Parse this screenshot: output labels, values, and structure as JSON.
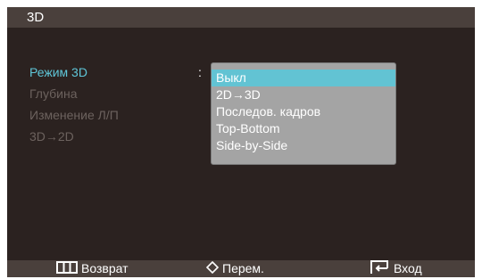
{
  "osd": {
    "title": "3D",
    "menu": [
      {
        "label": "Режим 3D",
        "active": true
      },
      {
        "label": "Глубина",
        "active": false
      },
      {
        "label": "Изменение Л/П",
        "active": false
      },
      {
        "label": "3D→2D",
        "active": false
      }
    ],
    "separator": ":",
    "dropdown": {
      "options": [
        "Выкл",
        "2D→3D",
        "Последов. кадров",
        "Top-Bottom",
        "Side-by-Side"
      ],
      "selected": "Выкл"
    },
    "footer": {
      "back": {
        "icon": "menu-icon",
        "label": "Возврат"
      },
      "move": {
        "icon": "updown-arrows-icon",
        "label": "Перем."
      },
      "enter": {
        "icon": "enter-icon",
        "label": "Вход"
      }
    }
  },
  "colors": {
    "background": "#2b2220",
    "bar": "#4a403c",
    "active_text": "#5fc6d8",
    "inactive_text": "#6c625e",
    "highlight": "#62c3d3",
    "dropdown_bg": "#a4a4a4"
  }
}
